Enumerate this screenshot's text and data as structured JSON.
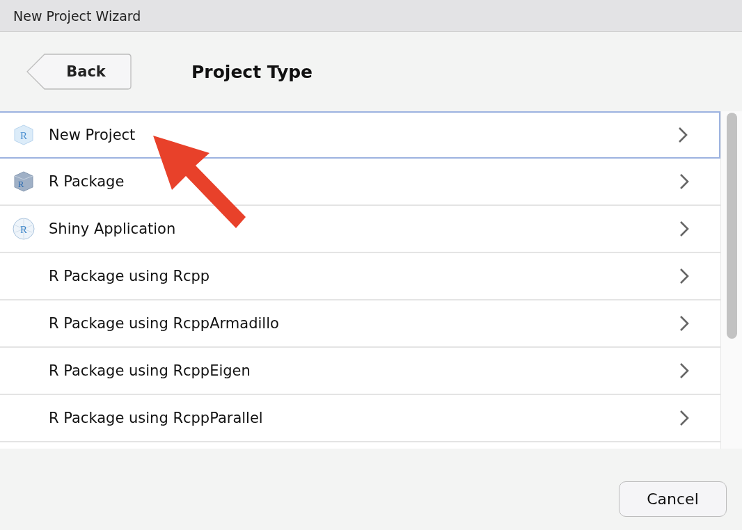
{
  "window": {
    "title": "New Project Wizard"
  },
  "header": {
    "back_button": "Back",
    "title": "Project Type"
  },
  "items": [
    {
      "label": "New Project",
      "kind": "project",
      "icon_text": "R",
      "selected": true
    },
    {
      "label": "R Package",
      "kind": "package",
      "icon_text": "R",
      "selected": false
    },
    {
      "label": "Shiny Application",
      "kind": "shiny",
      "icon_text": "R",
      "selected": false
    },
    {
      "label": "R Package using Rcpp",
      "kind": "plain",
      "selected": false
    },
    {
      "label": "R Package using RcppArmadillo",
      "kind": "plain",
      "selected": false
    },
    {
      "label": "R Package using RcppEigen",
      "kind": "plain",
      "selected": false
    },
    {
      "label": "R Package using RcppParallel",
      "kind": "plain",
      "selected": false
    }
  ],
  "footer": {
    "cancel_button": "Cancel"
  }
}
